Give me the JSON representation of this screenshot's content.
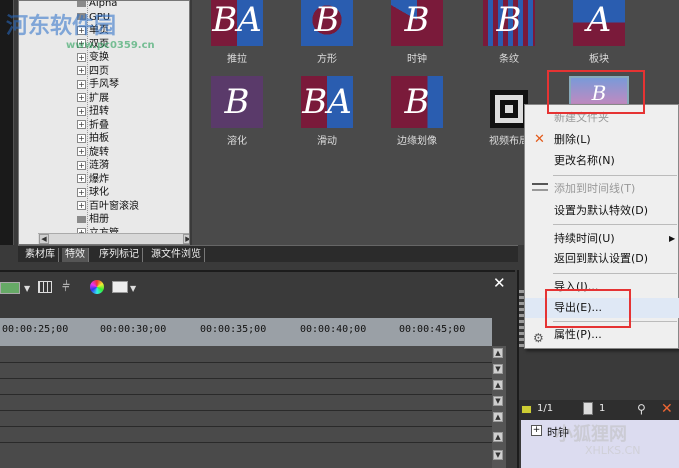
{
  "tree": {
    "items": [
      {
        "label": "Alpha",
        "type": "fold"
      },
      {
        "label": "GPU",
        "type": "fold"
      },
      {
        "label": "单页",
        "type": "exp"
      },
      {
        "label": "双页",
        "type": "exp"
      },
      {
        "label": "变换",
        "type": "exp"
      },
      {
        "label": "四页",
        "type": "exp"
      },
      {
        "label": "手风琴",
        "type": "exp"
      },
      {
        "label": "扩展",
        "type": "exp"
      },
      {
        "label": "扭转",
        "type": "exp"
      },
      {
        "label": "折叠",
        "type": "exp"
      },
      {
        "label": "拍板",
        "type": "exp"
      },
      {
        "label": "旋转",
        "type": "exp"
      },
      {
        "label": "涟漪",
        "type": "exp"
      },
      {
        "label": "爆炸",
        "type": "exp"
      },
      {
        "label": "球化",
        "type": "exp"
      },
      {
        "label": "百叶窗滚浪",
        "type": "exp"
      },
      {
        "label": "相册",
        "type": "fold"
      },
      {
        "label": "立方管",
        "type": "exp"
      }
    ]
  },
  "effects": [
    {
      "label": "推拉",
      "letters": "BA",
      "bg": "#2a5db0",
      "fg": "#7a1a3a",
      "style": "split"
    },
    {
      "label": "方形",
      "letters": "B",
      "bg": "#2a5db0",
      "fg": "#7a1a3a",
      "style": "inset"
    },
    {
      "label": "时钟",
      "letters": "B",
      "bg": "#2a5db0",
      "fg": "#7a1a3a",
      "style": "wedge"
    },
    {
      "label": "条纹",
      "letters": "B",
      "bg": "#2a5db0",
      "fg": "#7a1a3a",
      "style": "stripes"
    },
    {
      "label": "板块",
      "letters": "A",
      "bg": "#2a5db0",
      "fg": "#7a1a3a",
      "style": "blocks"
    },
    {
      "label": "溶化",
      "letters": "B",
      "bg": "#5a3a6a",
      "fg": "#5a3a6a",
      "style": "blend"
    },
    {
      "label": "滑动",
      "letters": "BA",
      "bg": "#2a5db0",
      "fg": "#7a1a3a",
      "style": "split"
    },
    {
      "label": "边缘划像",
      "letters": "B",
      "bg": "#2a5db0",
      "fg": "#7a1a3a",
      "style": "edge"
    },
    {
      "label": "视频布局",
      "letters": "",
      "bg": "#dddddd",
      "fg": "#000000",
      "style": "layout"
    },
    {
      "label": "",
      "letters": "B",
      "bg": "#2a5db0",
      "fg": "#b07ab0",
      "style": "selected"
    }
  ],
  "tabs": [
    "素材库",
    "特效",
    "序列标记",
    "源文件浏览"
  ],
  "ruler": [
    "00:00:25;00",
    "00:00:30;00",
    "00:00:35;00",
    "00:00:40;00",
    "00:00:45;00"
  ],
  "context_menu": {
    "items": [
      {
        "label": "新建文件夹",
        "disabled": true
      },
      {
        "label": "删除(L)",
        "disabled": false,
        "icon": "delete-icon"
      },
      {
        "label": "更改名称(N)",
        "disabled": false
      },
      {
        "label": "添加到时间线(T)",
        "disabled": true,
        "icon": "timeline-add-icon"
      },
      {
        "label": "设置为默认特效(D)",
        "disabled": false
      },
      {
        "label": "持续时间(U)",
        "disabled": false,
        "submenu": true
      },
      {
        "label": "返回到默认设置(D)",
        "disabled": false
      },
      {
        "label": "导入(I)...",
        "disabled": false
      },
      {
        "label": "导出(E)...",
        "disabled": false
      },
      {
        "label": "属性(P)...",
        "disabled": false,
        "icon": "properties-icon"
      }
    ]
  },
  "right_panel": {
    "page_label": "1/1",
    "count": "1",
    "bin_item": "时钟"
  },
  "watermarks": {
    "top": "河东软件园",
    "url": "www.pc0359.cn",
    "bottom": "小狐狸网",
    "bottom_url": "XHLKS.CN"
  },
  "colors": {
    "highlight_box": "#e53333",
    "menu_bg": "#efefef"
  }
}
